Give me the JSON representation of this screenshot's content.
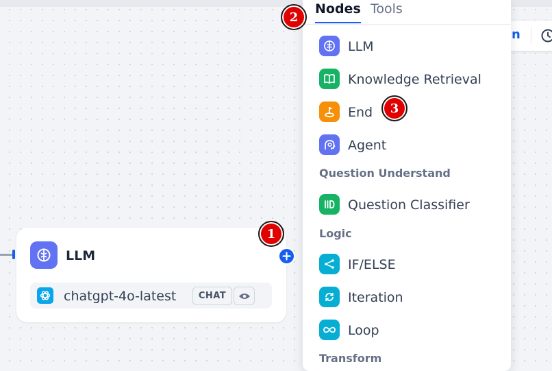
{
  "toolbar": {
    "fragment_text": "n",
    "clock_icon": "clock-icon"
  },
  "canvas": {
    "llm_node": {
      "title": "LLM",
      "icon": "llm-brain-icon",
      "model": {
        "name": "chatgpt-4o-latest",
        "badge": "CHAT",
        "vision_icon": "eye-icon"
      }
    }
  },
  "panel": {
    "tabs": [
      {
        "label": "Nodes",
        "active": true
      },
      {
        "label": "Tools",
        "active": false
      }
    ],
    "items": [
      {
        "label": "LLM",
        "icon": "llm-brain-icon",
        "color": "#6172f3"
      },
      {
        "label": "Knowledge Retrieval",
        "icon": "book-icon",
        "color": "#16b364"
      },
      {
        "label": "End",
        "icon": "end-flag-icon",
        "color": "#f79009"
      },
      {
        "label": "Agent",
        "icon": "agent-icon",
        "color": "#6172f3"
      },
      {
        "label": "Question Classifier",
        "icon": "classifier-icon",
        "color": "#16b364"
      },
      {
        "label": "IF/ELSE",
        "icon": "branch-icon",
        "color": "#06aed4"
      },
      {
        "label": "Iteration",
        "icon": "iteration-icon",
        "color": "#06aed4"
      },
      {
        "label": "Loop",
        "icon": "loop-icon",
        "color": "#06aed4"
      }
    ],
    "sections": [
      {
        "label": "Question Understand"
      },
      {
        "label": "Logic"
      },
      {
        "label": "Transform"
      }
    ]
  },
  "markers": [
    "1",
    "2",
    "3"
  ]
}
